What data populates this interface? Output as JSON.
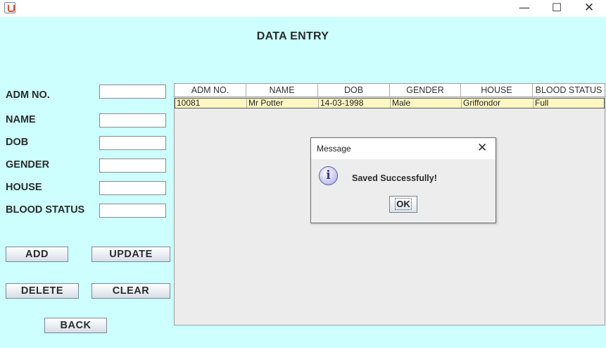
{
  "window": {
    "minimize_glyph": "—",
    "maximize_glyph": "☐",
    "close_glyph": "✕"
  },
  "form": {
    "title": "DATA ENTRY",
    "fields": [
      {
        "label": "ADM NO.",
        "value": ""
      },
      {
        "label": "NAME",
        "value": ""
      },
      {
        "label": "DOB",
        "value": ""
      },
      {
        "label": "GENDER",
        "value": ""
      },
      {
        "label": "HOUSE",
        "value": ""
      },
      {
        "label": "BLOOD STATUS",
        "value": ""
      }
    ],
    "buttons": {
      "add": "ADD",
      "update": "UPDATE",
      "delete": "DELETE",
      "clear": "CLEAR",
      "back": "BACK"
    }
  },
  "table": {
    "columns": [
      "ADM NO.",
      "NAME",
      "DOB",
      "GENDER",
      "HOUSE",
      "BLOOD STATUS"
    ],
    "rows": [
      [
        "10081",
        "Mr Potter",
        "14-03-1998",
        "Male",
        "Griffondor",
        "Full"
      ]
    ]
  },
  "dialog": {
    "title": "Message",
    "icon": "information-icon",
    "icon_glyph": "i",
    "close_glyph": "✕",
    "message": "Saved Successfully!",
    "ok_label": "OK"
  },
  "colors": {
    "background": "#ccfffe",
    "row_highlight": "#fff7c2"
  }
}
